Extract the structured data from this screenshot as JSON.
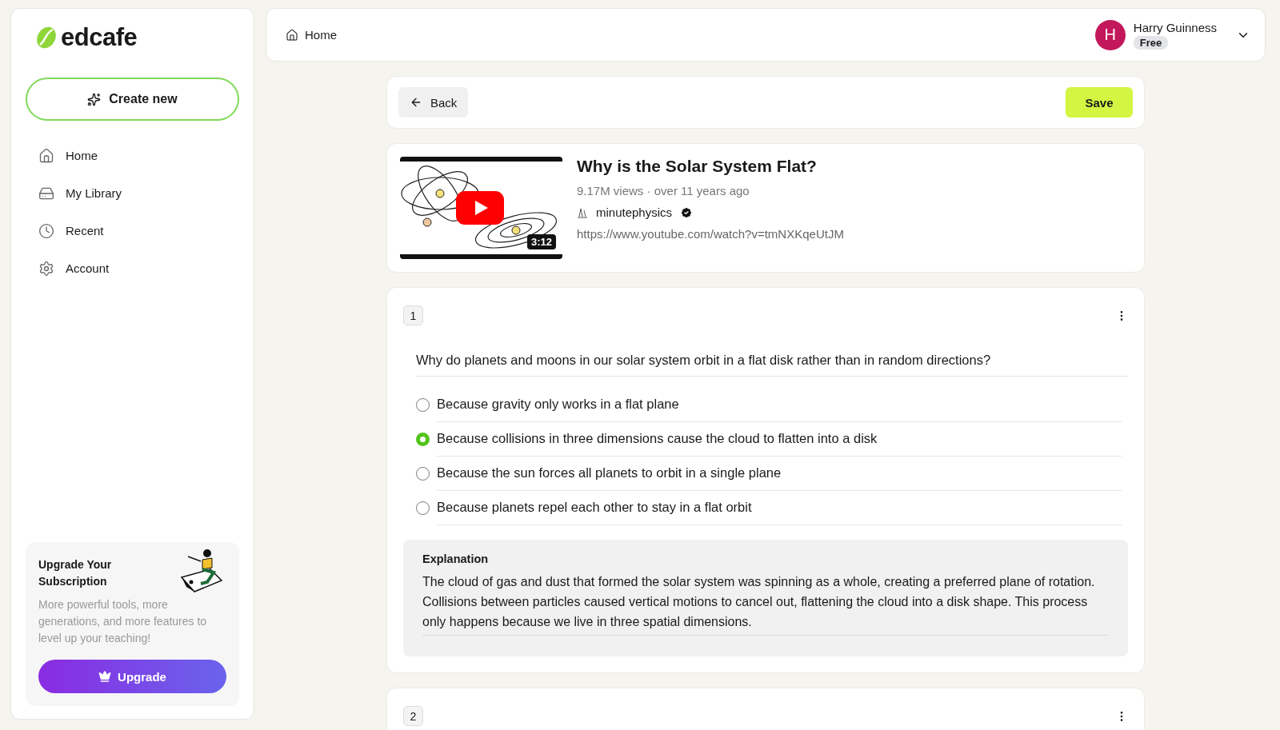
{
  "brand": {
    "name": "edcafe"
  },
  "sidebar": {
    "create_button": "Create new",
    "items": [
      {
        "label": "Home",
        "selected": false
      },
      {
        "label": "My Library",
        "selected": false
      },
      {
        "label": "Recent",
        "selected": false
      },
      {
        "label": "Account",
        "selected": false
      }
    ],
    "upgrade": {
      "title": "Upgrade Your Subscription",
      "text": "More powerful tools, more generations, and more features to level up your teaching!",
      "button": "Upgrade"
    }
  },
  "topbar": {
    "breadcrumb": "Home",
    "user": {
      "initial": "H",
      "name": "Harry Guinness",
      "plan": "Free"
    }
  },
  "toolbar": {
    "back": "Back",
    "save": "Save"
  },
  "video": {
    "duration": "3:12",
    "title": "Why is the Solar System Flat?",
    "meta": "9.17M views · over 11 years ago",
    "channel": "minutephysics",
    "verified": true,
    "url": "https://www.youtube.com/watch?v=tmNXKqeUtJM"
  },
  "questions": [
    {
      "number": "1",
      "question": "Why do planets and moons in our solar system orbit in a flat disk rather than in random directions?",
      "options": [
        {
          "text": "Because gravity only works in a flat plane",
          "selected": false
        },
        {
          "text": "Because collisions in three dimensions cause the cloud to flatten into a disk",
          "selected": true
        },
        {
          "text": "Because the sun forces all planets to orbit in a single plane",
          "selected": false
        },
        {
          "text": "Because planets repel each other to stay in a flat orbit",
          "selected": false
        }
      ],
      "explanation_label": "Explanation",
      "explanation": "The cloud of gas and dust that formed the solar system was spinning as a whole, creating a preferred plane of rotation. Collisions between particles caused vertical motions to cancel out, flattening the cloud into a disk shape. This process only happens because we live in three spatial dimensions."
    },
    {
      "number": "2"
    }
  ]
}
